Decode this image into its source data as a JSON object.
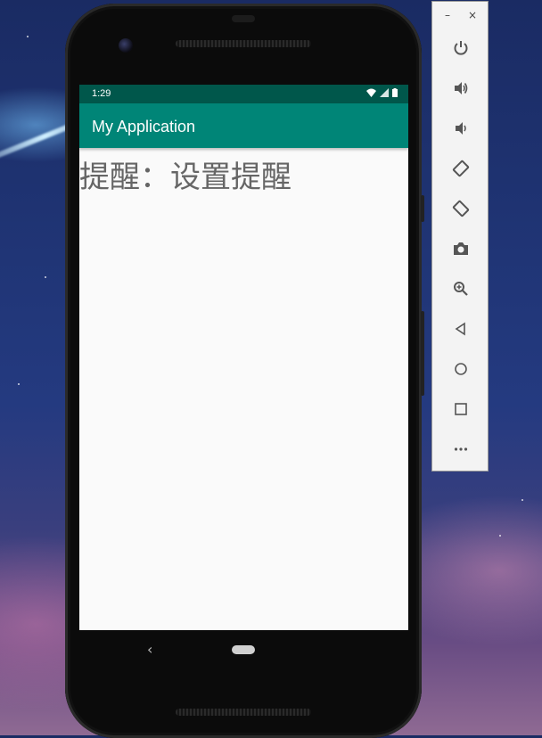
{
  "device": {
    "status_bar": {
      "time": "1:29"
    },
    "app_bar": {
      "title": "My Application"
    },
    "content": {
      "text": "提醒：设置提醒"
    }
  },
  "emulator_toolbar": {
    "window_controls": {
      "minimize": "–",
      "close": "×"
    },
    "buttons": [
      {
        "name": "power-icon"
      },
      {
        "name": "volume-up-icon"
      },
      {
        "name": "volume-down-icon"
      },
      {
        "name": "rotate-left-icon"
      },
      {
        "name": "rotate-right-icon"
      },
      {
        "name": "camera-icon"
      },
      {
        "name": "zoom-icon"
      },
      {
        "name": "back-icon"
      },
      {
        "name": "home-icon"
      },
      {
        "name": "overview-icon"
      },
      {
        "name": "more-icon"
      }
    ]
  },
  "colors": {
    "status_bar": "#00574b",
    "app_bar": "#008577",
    "screen_bg": "#fafafa",
    "content_text": "#666666"
  }
}
